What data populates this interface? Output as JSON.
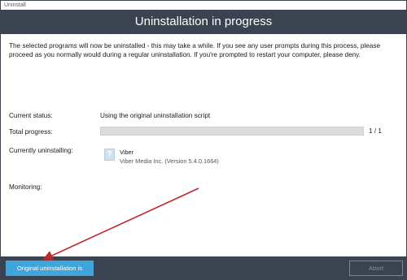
{
  "window": {
    "title": "Uninstall"
  },
  "header": {
    "title": "Uninstallation in progress"
  },
  "intro": {
    "text": "The selected programs will now be uninstalled - this may take a while. If you see any user prompts during this process, please proceed as you normally would during a regular uninstallation. If you're prompted to restart your computer, please deny."
  },
  "status": {
    "current_status_label": "Current status:",
    "current_status_value": "Using the original uninstallation script",
    "total_progress_label": "Total progress:",
    "total_progress_fraction": 0,
    "total_progress_count": "1 / 1",
    "currently_uninstalling_label": "Currently uninstalling:",
    "monitoring_label": "Monitoring:"
  },
  "program": {
    "icon": "question-mark-icon",
    "icon_glyph": "?",
    "name": "Viber",
    "description": "Viber Media Inc. (Version 5.4.0.1664)"
  },
  "footer": {
    "complete_button": "Original uninstallation is complete",
    "abort_button": "Abort"
  },
  "colors": {
    "header_bg": "#3b4250",
    "primary_button": "#3ea6dc",
    "annotation_arrow": "#c0282a"
  }
}
